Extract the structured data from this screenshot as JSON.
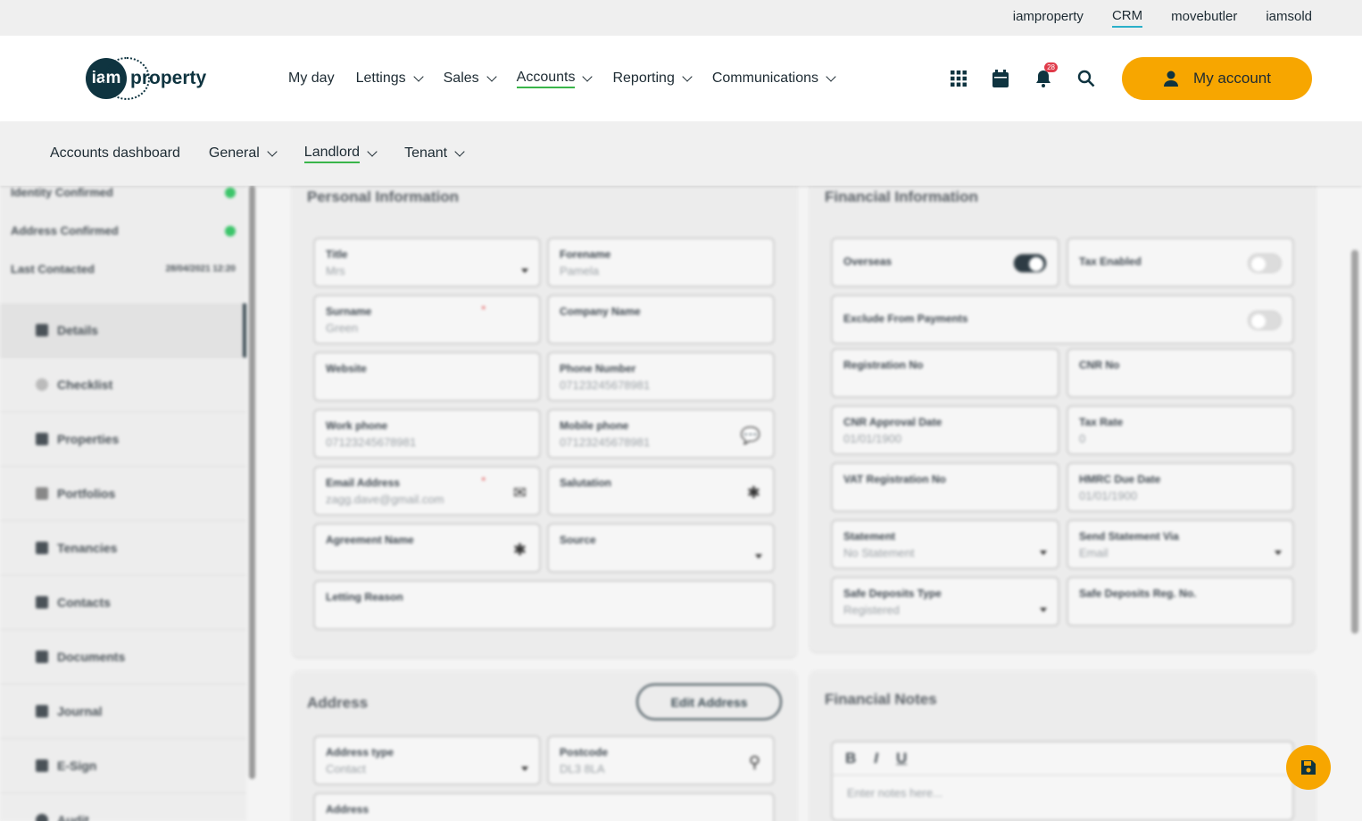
{
  "topbar": {
    "links": [
      "iamproperty",
      "CRM",
      "movebutler",
      "iamsold"
    ],
    "active": "CRM"
  },
  "logo": {
    "mark": "iam",
    "word": "property"
  },
  "nav": {
    "items": [
      {
        "label": "My day"
      },
      {
        "label": "Lettings"
      },
      {
        "label": "Sales"
      },
      {
        "label": "Accounts"
      },
      {
        "label": "Reporting"
      },
      {
        "label": "Communications"
      }
    ],
    "active": "Accounts"
  },
  "header": {
    "notification_count": "28",
    "my_account": "My account"
  },
  "subnav": {
    "items": [
      {
        "label": "Accounts dashboard"
      },
      {
        "label": "General"
      },
      {
        "label": "Landlord"
      },
      {
        "label": "Tenant"
      }
    ],
    "active": "Landlord"
  },
  "sidebar": {
    "status": [
      {
        "label": "Identity Confirmed"
      },
      {
        "label": "Address Confirmed"
      },
      {
        "label": "Last Contacted",
        "value": "28/04/2021 12:20"
      }
    ],
    "items": [
      {
        "label": "Details"
      },
      {
        "label": "Checklist"
      },
      {
        "label": "Properties"
      },
      {
        "label": "Portfolios"
      },
      {
        "label": "Tenancies"
      },
      {
        "label": "Contacts"
      },
      {
        "label": "Documents"
      },
      {
        "label": "Journal"
      },
      {
        "label": "E-Sign"
      },
      {
        "label": "Audit"
      }
    ]
  },
  "personal": {
    "title": "Personal Information",
    "fields": {
      "title": {
        "label": "Title",
        "value": "Mrs"
      },
      "forename": {
        "label": "Forename",
        "value": "Pamela"
      },
      "surname": {
        "label": "Surname",
        "value": "Green"
      },
      "company": {
        "label": "Company Name",
        "value": ""
      },
      "website": {
        "label": "Website",
        "value": ""
      },
      "phone": {
        "label": "Phone Number",
        "value": "07123245678981"
      },
      "work": {
        "label": "Work phone",
        "value": "07123245678981"
      },
      "mobile": {
        "label": "Mobile phone",
        "value": "07123245678981"
      },
      "email": {
        "label": "Email Address",
        "value": "zagg.dave@gmail.com"
      },
      "salutation": {
        "label": "Salutation",
        "value": ""
      },
      "agreement": {
        "label": "Agreement Name",
        "value": ""
      },
      "source": {
        "label": "Source",
        "value": ""
      },
      "letting": {
        "label": "Letting Reason",
        "value": ""
      }
    }
  },
  "financial": {
    "title": "Financial Information",
    "fields": {
      "overseas": {
        "label": "Overseas"
      },
      "tax_enabled": {
        "label": "Tax Enabled"
      },
      "exclude": {
        "label": "Exclude From Payments"
      },
      "reg_no": {
        "label": "Registration No",
        "value": ""
      },
      "cnr_no": {
        "label": "CNR No",
        "value": ""
      },
      "cnr_date": {
        "label": "CNR Approval Date",
        "value": "01/01/1900"
      },
      "tax_rate": {
        "label": "Tax Rate",
        "value": "0"
      },
      "vat": {
        "label": "VAT Registration No",
        "value": ""
      },
      "hmrc": {
        "label": "HMRC Due Date",
        "value": "01/01/1900"
      },
      "statement": {
        "label": "Statement",
        "value": "No Statement"
      },
      "send_via": {
        "label": "Send Statement Via",
        "value": "Email"
      },
      "deposit_type": {
        "label": "Safe Deposits Type",
        "value": "Registered"
      },
      "deposit_reg": {
        "label": "Safe Deposits Reg. No.",
        "value": ""
      }
    }
  },
  "address": {
    "title": "Address",
    "edit_button": "Edit Address",
    "fields": {
      "type": {
        "label": "Address type",
        "value": "Contact"
      },
      "postcode": {
        "label": "Postcode",
        "value": "DL3 8LA"
      },
      "address": {
        "label": "Address",
        "value": ""
      }
    }
  },
  "notes": {
    "title": "Financial Notes",
    "placeholder": "Enter notes here...",
    "bold": "B",
    "italic": "I",
    "underline": "U"
  },
  "colors": {
    "accent": "#f7a600",
    "active_underline": "#39b54a",
    "brand": "#0f3440"
  }
}
